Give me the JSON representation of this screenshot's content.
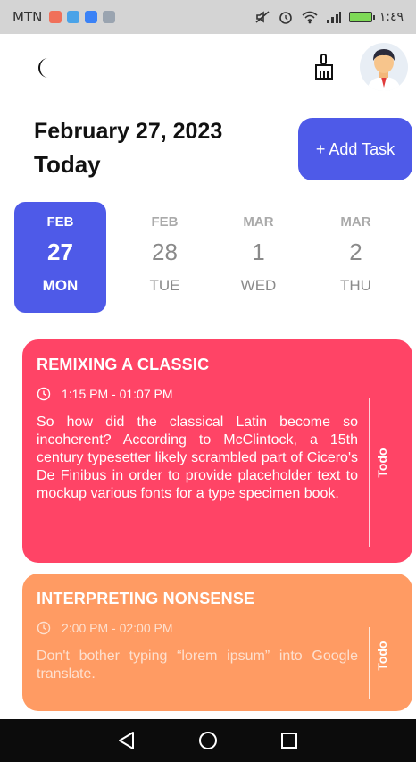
{
  "status_bar": {
    "carrier": "MTN",
    "time": "١:٤٩"
  },
  "header": {
    "date": "February 27, 2023",
    "today": "Today",
    "add_task_label": "+ Add Task"
  },
  "days": [
    {
      "month": "FEB",
      "day": "27",
      "weekday": "MON",
      "selected": true
    },
    {
      "month": "FEB",
      "day": "28",
      "weekday": "TUE",
      "selected": false
    },
    {
      "month": "MAR",
      "day": "1",
      "weekday": "WED",
      "selected": false
    },
    {
      "month": "MAR",
      "day": "2",
      "weekday": "THU",
      "selected": false
    }
  ],
  "tasks": [
    {
      "title": "REMIXING A CLASSIC",
      "time": "1:15 PM - 01:07 PM",
      "description": "So how did the classical Latin become so incoherent? According to McClintock, a 15th century typesetter likely scrambled part of Cicero's De Finibus in order to provide placeholder text to mockup various fonts for a type specimen book.",
      "status": "Todo",
      "color": "#ff4466"
    },
    {
      "title": "INTERPRETING NONSENSE",
      "time": "2:00 PM - 02:00 PM",
      "description": "Don't bother typing “lorem ipsum” into Google translate.",
      "status": "Todo",
      "color": "#ff9b63"
    }
  ],
  "colors": {
    "accent": "#4e5ae8",
    "task_red": "#ff4466",
    "task_orange": "#ff9b63"
  },
  "icons": {
    "theme": "moon-icon",
    "clear": "broom-icon",
    "profile": "avatar",
    "time": "clock-icon",
    "nav_back": "back-triangle-icon",
    "nav_home": "home-circle-icon",
    "nav_recents": "recents-square-icon"
  }
}
